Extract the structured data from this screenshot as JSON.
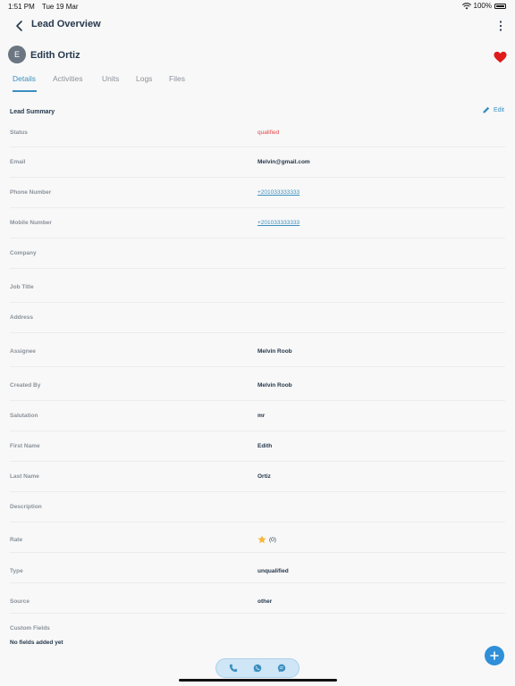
{
  "status_bar": {
    "time": "1:51 PM",
    "date": "Tue 19 Mar",
    "battery": "100%"
  },
  "nav": {
    "title": "Lead Overview"
  },
  "profile": {
    "initial": "E",
    "name": "Edith Ortiz"
  },
  "tabs": [
    {
      "label": "Details",
      "active": true
    },
    {
      "label": "Activities",
      "active": false
    },
    {
      "label": "Units",
      "active": false
    },
    {
      "label": "Logs",
      "active": false
    },
    {
      "label": "Files",
      "active": false
    }
  ],
  "summary": {
    "title": "Lead Summary",
    "edit_label": "Edit"
  },
  "fields": [
    {
      "label": "Status",
      "value": "qualified"
    },
    {
      "label": "Email",
      "value": "Melvin@gmail.com"
    },
    {
      "label": "Phone Number",
      "value": "+201033333333"
    },
    {
      "label": "Mobile Number",
      "value": "+201033333333"
    },
    {
      "label": "Company",
      "value": ""
    },
    {
      "label": "Job Title",
      "value": ""
    },
    {
      "label": "Address",
      "value": ""
    },
    {
      "label": "Assignee",
      "value": "Melvin Roob"
    },
    {
      "label": "Created By",
      "value": "Melvin Roob"
    },
    {
      "label": "Salutation",
      "value": "mr"
    },
    {
      "label": "First Name",
      "value": "Edith"
    },
    {
      "label": "Last Name",
      "value": "Ortiz"
    },
    {
      "label": "Description",
      "value": ""
    },
    {
      "label": "Rate",
      "value": "(0)"
    },
    {
      "label": "Type",
      "value": "unqualified"
    },
    {
      "label": "Source",
      "value": "other"
    }
  ],
  "custom_fields": {
    "label": "Custom Fields",
    "empty_text": "No fields added yet"
  },
  "colors": {
    "accent": "#3a8fbf",
    "status": "#e04848",
    "heart": "#e01b1b",
    "fab": "#2f8fd8"
  },
  "icons": [
    "back-chevron-icon",
    "more-vertical-icon",
    "heart-icon",
    "pencil-icon",
    "star-icon",
    "phone-icon",
    "whatsapp-icon",
    "chat-icon",
    "plus-icon",
    "wifi-icon",
    "battery-icon"
  ]
}
